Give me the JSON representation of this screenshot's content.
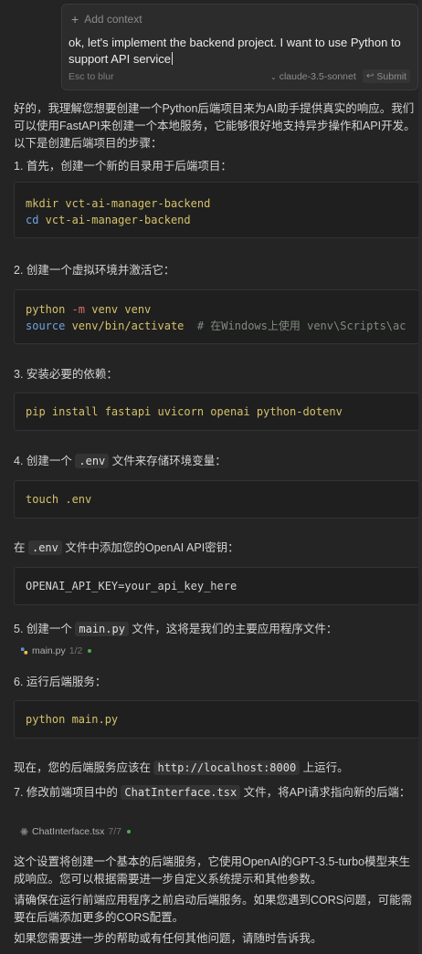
{
  "input": {
    "add_context": "Add context",
    "prompt": "ok, let's implement the backend project. I want to use Python to support API service",
    "esc_hint": "Esc to blur",
    "model": "claude-3.5-sonnet",
    "submit": "Submit"
  },
  "response": {
    "intro": "好的，我理解您想要创建一个Python后端项目来为AI助手提供真实的响应。我们可以使用FastAPI来创建一个本地服务，它能够很好地支持异步操作和API开发。以下是创建后端项目的步骤：",
    "step1": "1. 首先，创建一个新的目录用于后端项目：",
    "code1_l1_cmd": "mkdir",
    "code1_l1_arg": " vct-ai-manager-backend",
    "code1_l2_cmd": "cd",
    "code1_l2_arg": " vct-ai-manager-backend",
    "step2": "2. 创建一个虚拟环境并激活它：",
    "code2_l1_a": "python ",
    "code2_l1_flag": "-m",
    "code2_l1_b": " venv venv",
    "code2_l2_a": "source",
    "code2_l2_b": " venv/bin/activate",
    "code2_l2_c": "  # 在Windows上使用 venv\\Scripts\\ac",
    "step3": "3. 安装必要的依赖：",
    "code3_cmd": "pip",
    "code3_args": " install fastapi uvicorn openai python-dotenv",
    "step4_a": "4. 创建一个 ",
    "step4_code": ".env",
    "step4_b": " 文件来存储环境变量：",
    "code4_cmd": "touch",
    "code4_arg": " .env",
    "env_a": "在 ",
    "env_code": ".env",
    "env_b": " 文件中添加您的OpenAI API密钥：",
    "code5": "OPENAI_API_KEY=your_api_key_here",
    "step5_a": "5. 创建一个 ",
    "step5_code": "main.py",
    "step5_b": " 文件，这将是我们的主要应用程序文件：",
    "file1_name": "main.py",
    "file1_ver": "1/2",
    "step6": "6. 运行后端服务：",
    "code6_cmd": "python",
    "code6_arg": " main.py",
    "running_a": "现在，您的后端服务应该在 ",
    "running_code": "http://localhost:8000",
    "running_b": " 上运行。",
    "step7_a": "7. 修改前端项目中的 ",
    "step7_code": "ChatInterface.tsx",
    "step7_b": " 文件，将API请求指向新的后端：",
    "file2_name": "ChatInterface.tsx",
    "file2_ver": "7/7",
    "para1": "这个设置将创建一个基本的后端服务，它使用OpenAI的GPT-3.5-turbo模型来生成响应。您可以根据需要进一步自定义系统提示和其他参数。",
    "para2": "请确保在运行前端应用程序之前启动后端服务。如果您遇到CORS问题，可能需要在后端添加更多的CORS配置。",
    "para3": "如果您需要进一步的帮助或有任何其他问题，请随时告诉我。"
  }
}
